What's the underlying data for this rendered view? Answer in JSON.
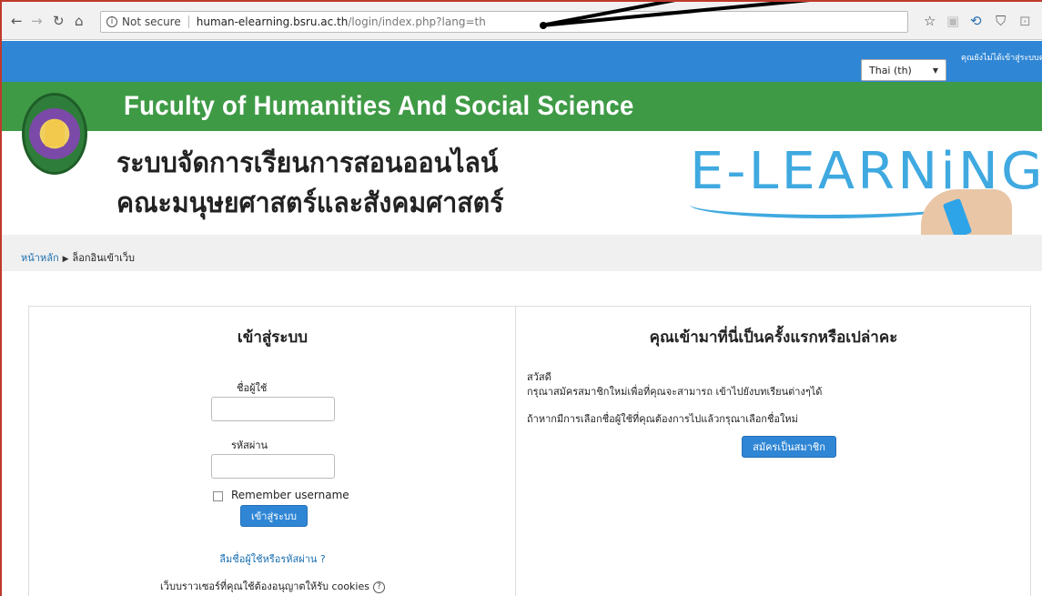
{
  "browser": {
    "security_label": "Not secure",
    "url_host": "human-elearning.bsru.ac.th",
    "url_path": "/login/index.php?lang=th"
  },
  "topbar": {
    "language_selected": "Thai (th)",
    "login_status": "คุณยังไม่ได้เข้าสู่ระบบค่ะ"
  },
  "banner": {
    "faculty_title": "Fuculty of Humanities And Social Science",
    "thai_line1": "ระบบจัดการเรียนการสอนออนไลน์",
    "thai_line2": "คณะมนุษยศาสตร์และสังคมศาสตร์",
    "brand": "E-LEARNiNG"
  },
  "breadcrumb": {
    "home": "หน้าหลัก",
    "current": "ล็อกอินเข้าเว็บ"
  },
  "login": {
    "heading": "เข้าสู่ระบบ",
    "username_label": "ชื่อผู้ใช้",
    "password_label": "รหัสผ่าน",
    "remember_label": "Remember username",
    "submit_label": "เข้าสู่ระบบ",
    "forgot_link": "ลืมชื่อผู้ใช้หรือรหัสผ่าน ?",
    "cookies_note": "เว็บบราวเซอร์ที่คุณใช้ต้องอนุญาตให้รับ cookies"
  },
  "first_time": {
    "heading": "คุณเข้ามาที่นี่เป็นครั้งแรกหรือเปล่าคะ",
    "greeting": "สวัสดี",
    "line1": "กรุณาสมัครสมาชิกใหม่เพื่อที่คุณจะสามารถ เข้าไปยังบทเรียนต่างๆได้",
    "line2": "ถ้าหากมีการเลือกชื่อผู้ใช้ที่คุณต้องการไปแล้วกรุณาเลือกชื่อใหม่",
    "signup_label": "สมัครเป็นสมาชิก"
  },
  "colors": {
    "topbar": "#2f86d5",
    "green_band": "#3f9a46",
    "brand_blue": "#3fa9e0",
    "link": "#1a6fb0"
  }
}
